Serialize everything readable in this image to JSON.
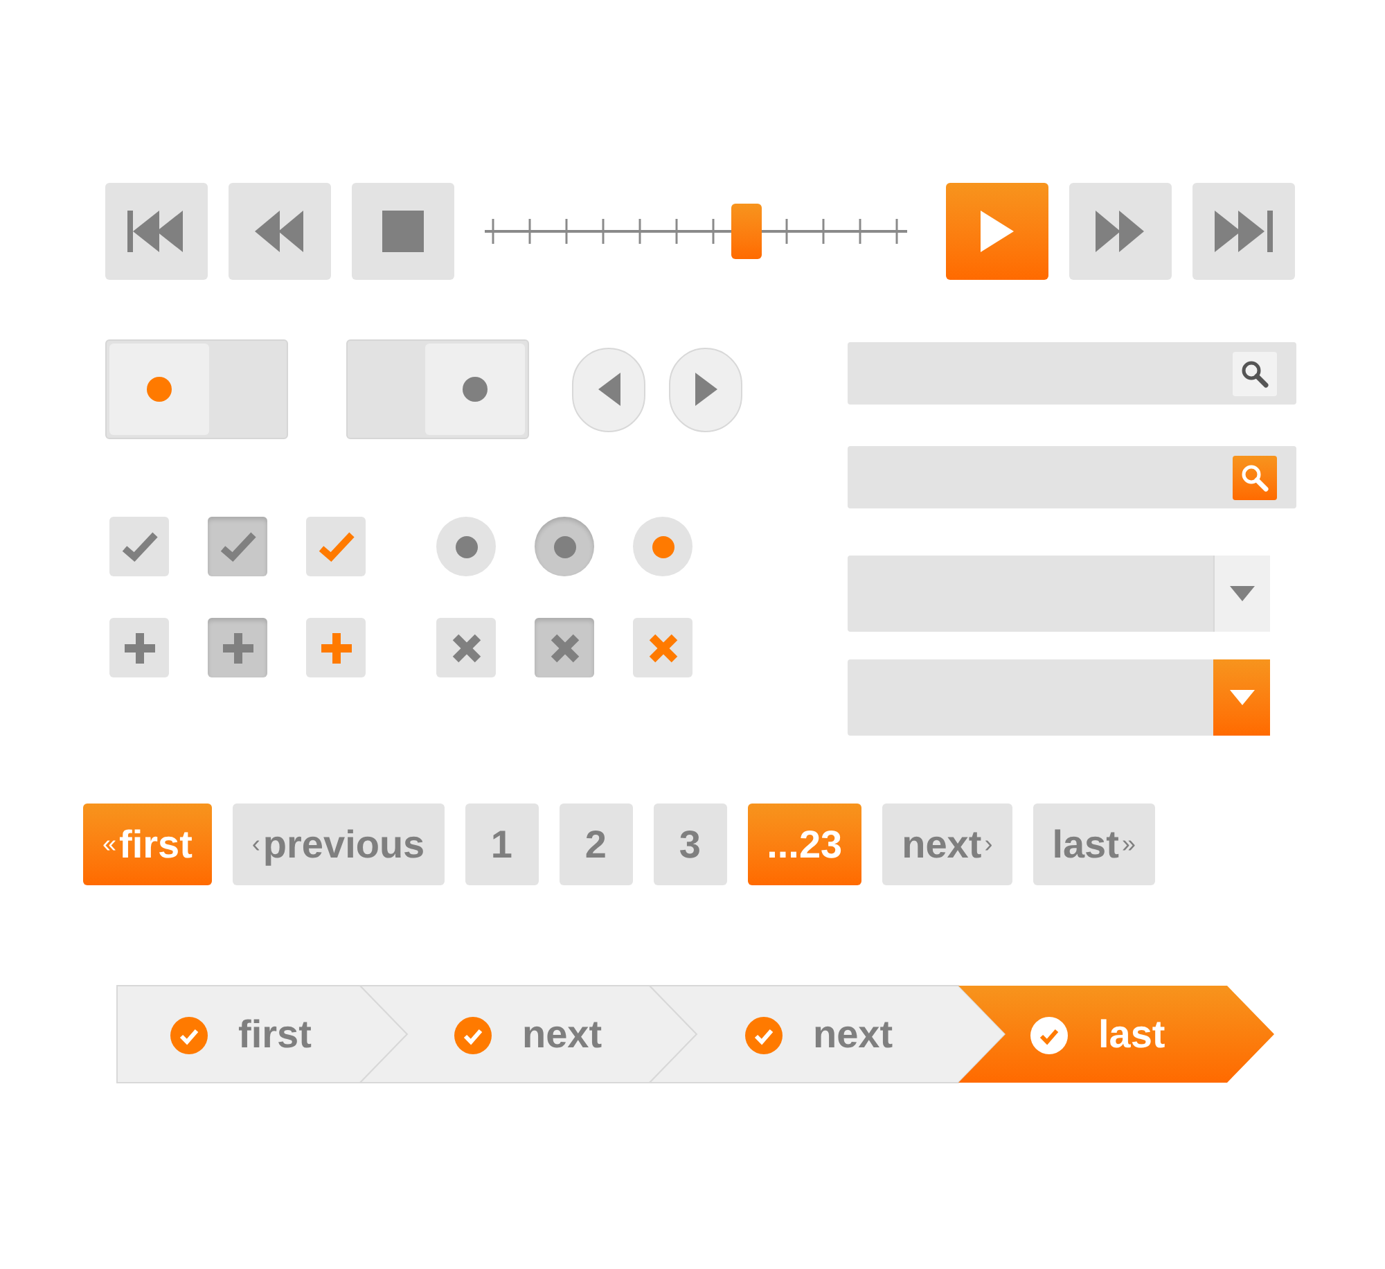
{
  "media_bar": {
    "buttons": [
      {
        "kind": "skip-back",
        "selected": false
      },
      {
        "kind": "rewind",
        "selected": false
      },
      {
        "kind": "stop",
        "selected": false
      }
    ],
    "slider": {
      "level": 0.62
    },
    "buttons_right": [
      {
        "kind": "play",
        "selected": true
      },
      {
        "kind": "fast-forward",
        "selected": false
      },
      {
        "kind": "skip-forward",
        "selected": false
      }
    ]
  },
  "toggles": [
    {
      "on": true
    },
    {
      "on": false
    }
  ],
  "arrow_buttons": [
    {
      "kind": "left"
    },
    {
      "kind": "right"
    }
  ],
  "icon_controls": [
    {
      "kind": "check",
      "pressed": false,
      "highlighted": false
    },
    {
      "kind": "check",
      "pressed": true,
      "highlighted": false
    },
    {
      "kind": "check",
      "pressed": false,
      "highlighted": true
    },
    {
      "kind": "radio",
      "pressed": false,
      "highlighted": false
    },
    {
      "kind": "radio",
      "pressed": true,
      "highlighted": false
    },
    {
      "kind": "radio",
      "pressed": false,
      "highlighted": true
    },
    {
      "kind": "plus",
      "pressed": false,
      "highlighted": false
    },
    {
      "kind": "plus",
      "pressed": true,
      "highlighted": false
    },
    {
      "kind": "plus",
      "pressed": false,
      "highlighted": true
    },
    {
      "kind": "cross",
      "pressed": false,
      "highlighted": false
    },
    {
      "kind": "cross",
      "pressed": true,
      "highlighted": false
    },
    {
      "kind": "cross",
      "pressed": false,
      "highlighted": true
    }
  ],
  "search_fields": [
    {
      "highlighted": false
    },
    {
      "highlighted": true
    }
  ],
  "dropdowns": [
    {
      "highlighted": false
    },
    {
      "highlighted": true
    }
  ],
  "pagination": [
    {
      "label": "first",
      "mark_before": "«",
      "selected": true
    },
    {
      "label": "previous",
      "mark_before": "‹",
      "selected": false
    },
    {
      "label": "1",
      "selected": false
    },
    {
      "label": "2",
      "selected": false
    },
    {
      "label": "3",
      "selected": false
    },
    {
      "label": "...23",
      "selected": true
    },
    {
      "label": "next",
      "mark_after": "›",
      "selected": false
    },
    {
      "label": "last",
      "mark_after": "»",
      "selected": false
    }
  ],
  "steps": [
    {
      "label": "first",
      "selected": false
    },
    {
      "label": "next",
      "selected": false
    },
    {
      "label": "next",
      "selected": false
    },
    {
      "label": "last",
      "selected": true
    }
  ]
}
